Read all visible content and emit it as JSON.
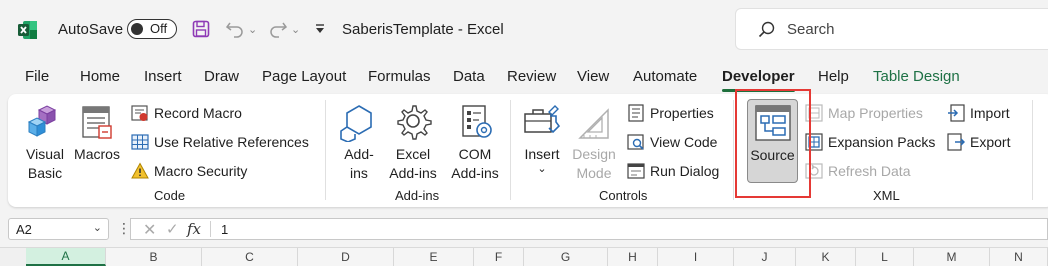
{
  "titlebar": {
    "autosave_label": "AutoSave",
    "autosave_state": "Off",
    "document_title": "SaberisTemplate  -  Excel",
    "search_placeholder": "Search"
  },
  "menu": {
    "tabs": [
      "File",
      "Home",
      "Insert",
      "Draw",
      "Page Layout",
      "Formulas",
      "Data",
      "Review",
      "View",
      "Automate",
      "Developer",
      "Help",
      "Table Design"
    ],
    "active_tab": "Developer",
    "context_tab": "Table Design"
  },
  "ribbon": {
    "code": {
      "label": "Code",
      "visual_basic": "Visual\nBasic",
      "macros": "Macros",
      "record_macro": "Record Macro",
      "relative_refs": "Use Relative References",
      "macro_security": "Macro Security"
    },
    "addins": {
      "label": "Add-ins",
      "addins": "Add-\nins",
      "excel_addins": "Excel\nAdd-ins",
      "com_addins": "COM\nAdd-ins"
    },
    "controls": {
      "label": "Controls",
      "insert": "Insert",
      "design_mode": "Design\nMode",
      "properties": "Properties",
      "view_code": "View Code",
      "run_dialog": "Run Dialog"
    },
    "xml": {
      "label": "XML",
      "source": "Source",
      "map_properties": "Map Properties",
      "expansion_packs": "Expansion Packs",
      "refresh_data": "Refresh Data",
      "import": "Import",
      "export": "Export"
    }
  },
  "formula_bar": {
    "name_box": "A2",
    "fx_label": "fx",
    "value": "1"
  },
  "columns": [
    "A",
    "B",
    "C",
    "D",
    "E",
    "F",
    "G",
    "H",
    "I",
    "J",
    "K",
    "L",
    "M",
    "N"
  ],
  "selected_column": "A",
  "colors": {
    "excel_green": "#1e7145",
    "highlight_red": "#e53935",
    "disabled_text": "#a8a8a8"
  }
}
